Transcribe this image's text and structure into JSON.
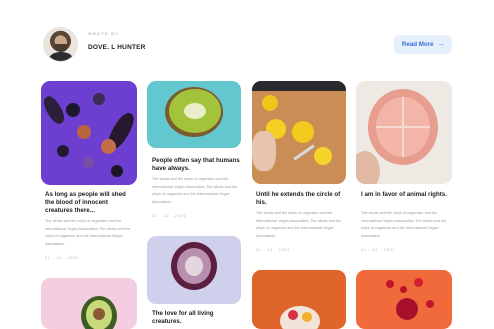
{
  "author": {
    "wrote_by": "WROTE BY",
    "name": "DOVE. L HUNTER"
  },
  "actions": {
    "read_more": "Read More",
    "read_more_arrow": "→"
  },
  "posts": [
    {
      "title": "As long as people will shed the blood of innocent creatures there...",
      "excerpt": "The whats and the whys of veganism and the International Vegan Association The whats and the whys of veganism and the International Vegan Association",
      "date": "21 . 12 . 2021",
      "image": "eggplant-figs-purple"
    },
    {
      "title": "People often say that humans have always.",
      "excerpt": "The whats and the whys of veganism and the International Vegan Association The whats and the whys of veganism and the International Vegan Association",
      "date": "21 . 12 . 2021",
      "image": "kiwi-teal"
    },
    {
      "title": "Until he extends the circle of his.",
      "excerpt": "The whats and the whys of veganism and the International Vegan Association The whats and the whys of veganism and the International Vegan Association",
      "date": "21 . 12 . 2021",
      "image": "yellow-fruit-cutting-board"
    },
    {
      "title": "I am in favor of animal rights.",
      "excerpt": "The whats and the whys of veganism and the International Vegan Association The whats and the whys of veganism and the International Vegan Association",
      "date": "21 . 12 . 2021",
      "image": "grapefruit-peel"
    },
    {
      "title": "The love for all living creatures.",
      "image": "artichoke-lilac"
    },
    {
      "image": "avocado-pink"
    },
    {
      "image": "fruit-bowl-rust"
    },
    {
      "image": "pomegranate-orange"
    }
  ]
}
